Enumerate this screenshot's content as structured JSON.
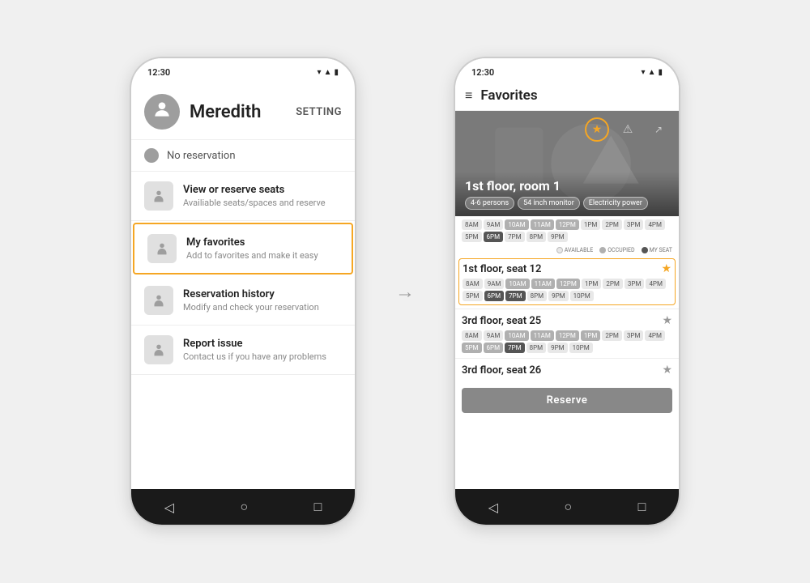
{
  "left_phone": {
    "time": "12:30",
    "profile": {
      "name": "Meredith",
      "setting_label": "SETTING"
    },
    "no_reservation": "No reservation",
    "menu_items": [
      {
        "title": "View or reserve seats",
        "subtitle": "Availiable seats/spaces and reserve"
      },
      {
        "title": "My favorites",
        "subtitle": "Add to favorites and make it easy",
        "active": true
      },
      {
        "title": "Reservation history",
        "subtitle": "Modify and check your reservation"
      },
      {
        "title": "Report issue",
        "subtitle": "Contact us if you have any problems"
      }
    ],
    "nav": {
      "back": "◁",
      "home": "○",
      "recent": "□"
    }
  },
  "right_phone": {
    "time": "12:30",
    "header": {
      "title": "Favorites"
    },
    "room": {
      "name": "1st floor, room 1",
      "tags": [
        "4-6 persons",
        "54 inch monitor",
        "Electricity power"
      ]
    },
    "time_slots_room": [
      "8AM",
      "9AM",
      "10AM",
      "11AM",
      "12PM",
      "1PM",
      "2PM",
      "3PM",
      "4PM",
      "5PM",
      "6PM",
      "7PM",
      "8PM",
      "9PM"
    ],
    "legend": {
      "available_label": "AVAILABLE",
      "occupied_label": "OCCUPIED",
      "my_seat_label": "MY SEAT"
    },
    "seats": [
      {
        "name": "1st floor, seat 12",
        "starred": true,
        "highlighted": true,
        "time_slots": [
          "8AM",
          "9AM",
          "10AM",
          "11AM",
          "12PM",
          "1PM",
          "2PM",
          "3PM",
          "4PM",
          "5PM",
          "6PM",
          "7PM",
          "8PM",
          "9PM",
          "10PM"
        ]
      },
      {
        "name": "3rd floor, seat 25",
        "starred": false,
        "highlighted": false,
        "time_slots": [
          "8AM",
          "9AM",
          "10AM",
          "11AM",
          "12PM",
          "1PM",
          "2PM",
          "3PM",
          "4PM",
          "5PM",
          "6PM",
          "7PM",
          "8PM",
          "9PM",
          "10PM"
        ]
      },
      {
        "name": "3rd floor, seat 26",
        "starred": false,
        "highlighted": false,
        "time_slots": []
      }
    ],
    "reserve_btn_label": "Reserve",
    "nav": {
      "back": "◁",
      "home": "○",
      "recent": "□"
    }
  },
  "arrow_label": "→",
  "accent_color": "#f5a623"
}
